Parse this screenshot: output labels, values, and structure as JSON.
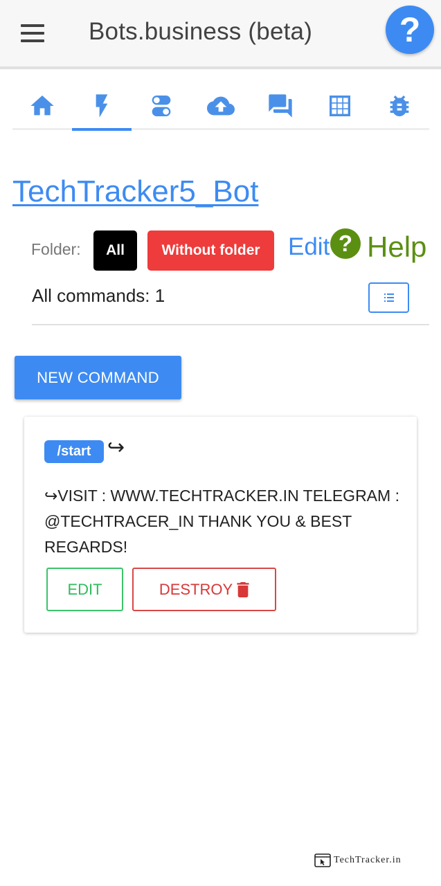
{
  "appbar": {
    "title": "Bots.business (beta)",
    "help_label": "?",
    "menu_icon": "hamburger-menu-icon"
  },
  "tabs": [
    {
      "icon": "home-icon",
      "active": false
    },
    {
      "icon": "flash-icon",
      "active": true
    },
    {
      "icon": "toggles-icon",
      "active": false
    },
    {
      "icon": "cloud-upload-icon",
      "active": false
    },
    {
      "icon": "chat-icon",
      "active": false
    },
    {
      "icon": "apps-grid-icon",
      "active": false
    },
    {
      "icon": "bug-icon",
      "active": false
    }
  ],
  "bot": {
    "name": "TechTracker5_Bot"
  },
  "folders": {
    "label": "Folder:",
    "all_label": "All",
    "without_label": "Without folder",
    "edit_label": "Edit",
    "help_icon_label": "?",
    "help_label": "Help"
  },
  "commands": {
    "count_text": "All commands: 1",
    "new_label": "NEW COMMAND",
    "items": [
      {
        "name": "/start",
        "arrow": "↪",
        "answer": "↪VISIT : WWW.TECHTRACKER.IN TELEGRAM : @TECHTRACER_IN THANK YOU & BEST REGARDS!",
        "edit_label": "EDIT",
        "destroy_label": "DESTROY"
      }
    ]
  },
  "watermark": {
    "text": "TechTracker.in"
  },
  "colors": {
    "primary": "#3d8bf2",
    "danger": "#ee3b3b",
    "success": "#2ebc5c",
    "help_green": "#5b8f12"
  }
}
